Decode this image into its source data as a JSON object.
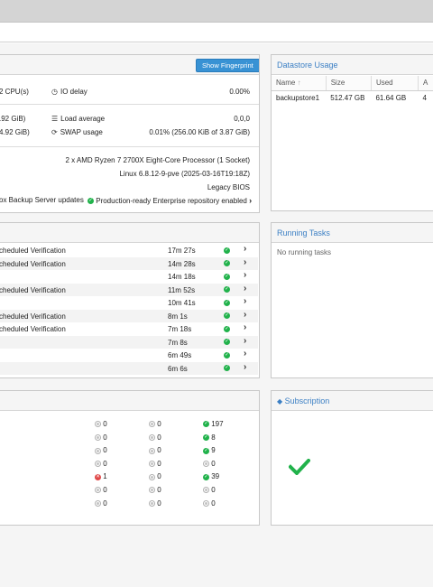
{
  "status_panel": {
    "fingerprint_button": "Show Fingerprint",
    "cpu_label": "2 CPU(s)",
    "io_delay_label": "IO delay",
    "io_delay_value": "0.00%",
    "mem_value": ".92 GiB)",
    "load_label": "Load average",
    "load_value": "0,0,0",
    "hd_value": "4.92 GiB)",
    "swap_label": "SWAP usage",
    "swap_value": "0.01% (256.00 KiB of 3.87 GiB)",
    "cpu_model": "2 x AMD Ryzen 7 2700X Eight-Core Processor (1 Socket)",
    "kernel": "Linux 6.8.12-9-pve (2025-03-16T19:18Z)",
    "boot_mode": "Legacy BIOS",
    "updates_label": "ox Backup Server updates",
    "repo_status": "Production-ready Enterprise repository enabled"
  },
  "datastore_usage": {
    "title": "Datastore Usage",
    "columns": [
      "Name",
      "Size",
      "Used",
      "A"
    ],
    "rows": [
      {
        "name": "backupstore1",
        "size": "512.47 GB",
        "used": "61.64 GB",
        "avail": "4"
      }
    ]
  },
  "tasks": {
    "rows": [
      {
        "name": "cheduled Verification",
        "duration": "17m 27s"
      },
      {
        "name": "cheduled Verification",
        "duration": "14m 28s"
      },
      {
        "name": "",
        "duration": "14m 18s"
      },
      {
        "name": "cheduled Verification",
        "duration": "11m 52s"
      },
      {
        "name": "",
        "duration": "10m 41s"
      },
      {
        "name": "cheduled Verification",
        "duration": "8m 1s"
      },
      {
        "name": "cheduled Verification",
        "duration": "7m 18s"
      },
      {
        "name": "",
        "duration": "7m 8s"
      },
      {
        "name": "",
        "duration": "6m 49s"
      },
      {
        "name": "",
        "duration": "6m 6s"
      }
    ]
  },
  "running_tasks": {
    "title": "Running Tasks",
    "empty_text": "No running tasks"
  },
  "task_summary": {
    "rows": [
      {
        "err": "0",
        "warn": "0",
        "ok": "197",
        "err_state": "none",
        "ok_state": "ok"
      },
      {
        "err": "0",
        "warn": "0",
        "ok": "8",
        "err_state": "none",
        "ok_state": "ok"
      },
      {
        "err": "0",
        "warn": "0",
        "ok": "9",
        "err_state": "none",
        "ok_state": "ok"
      },
      {
        "err": "0",
        "warn": "0",
        "ok": "0",
        "err_state": "none",
        "ok_state": "none"
      },
      {
        "err": "1",
        "warn": "0",
        "ok": "39",
        "err_state": "error",
        "ok_state": "ok"
      },
      {
        "err": "0",
        "warn": "0",
        "ok": "0",
        "err_state": "none",
        "ok_state": "none"
      },
      {
        "err": "0",
        "warn": "0",
        "ok": "0",
        "err_state": "none",
        "ok_state": "none"
      }
    ]
  },
  "subscription": {
    "title": "Subscription",
    "status_icon": "checkmark-icon",
    "status_color": "#21b24b"
  },
  "colors": {
    "accent": "#3b7fc4",
    "button": "#3892d4",
    "ok": "#21b24b",
    "error": "#e04848"
  }
}
